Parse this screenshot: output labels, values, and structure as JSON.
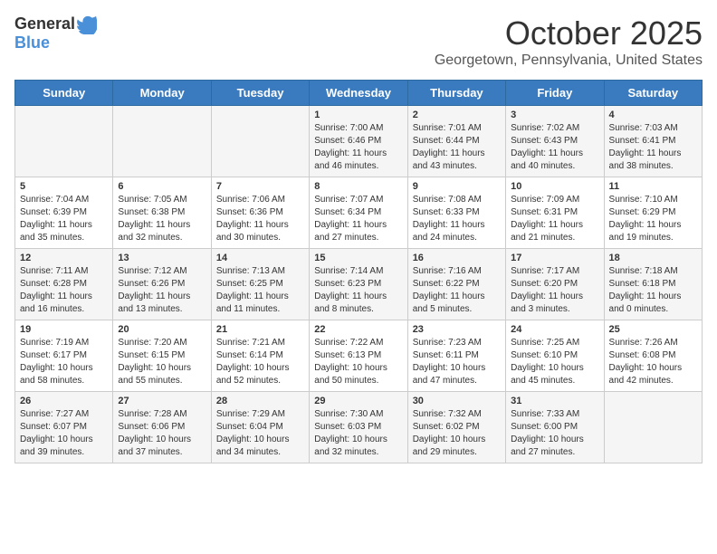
{
  "header": {
    "logo_general": "General",
    "logo_blue": "Blue",
    "month_title": "October 2025",
    "location": "Georgetown, Pennsylvania, United States"
  },
  "days_of_week": [
    "Sunday",
    "Monday",
    "Tuesday",
    "Wednesday",
    "Thursday",
    "Friday",
    "Saturday"
  ],
  "weeks": [
    [
      {
        "day": "",
        "info": ""
      },
      {
        "day": "",
        "info": ""
      },
      {
        "day": "",
        "info": ""
      },
      {
        "day": "1",
        "info": "Sunrise: 7:00 AM\nSunset: 6:46 PM\nDaylight: 11 hours and 46 minutes."
      },
      {
        "day": "2",
        "info": "Sunrise: 7:01 AM\nSunset: 6:44 PM\nDaylight: 11 hours and 43 minutes."
      },
      {
        "day": "3",
        "info": "Sunrise: 7:02 AM\nSunset: 6:43 PM\nDaylight: 11 hours and 40 minutes."
      },
      {
        "day": "4",
        "info": "Sunrise: 7:03 AM\nSunset: 6:41 PM\nDaylight: 11 hours and 38 minutes."
      }
    ],
    [
      {
        "day": "5",
        "info": "Sunrise: 7:04 AM\nSunset: 6:39 PM\nDaylight: 11 hours and 35 minutes."
      },
      {
        "day": "6",
        "info": "Sunrise: 7:05 AM\nSunset: 6:38 PM\nDaylight: 11 hours and 32 minutes."
      },
      {
        "day": "7",
        "info": "Sunrise: 7:06 AM\nSunset: 6:36 PM\nDaylight: 11 hours and 30 minutes."
      },
      {
        "day": "8",
        "info": "Sunrise: 7:07 AM\nSunset: 6:34 PM\nDaylight: 11 hours and 27 minutes."
      },
      {
        "day": "9",
        "info": "Sunrise: 7:08 AM\nSunset: 6:33 PM\nDaylight: 11 hours and 24 minutes."
      },
      {
        "day": "10",
        "info": "Sunrise: 7:09 AM\nSunset: 6:31 PM\nDaylight: 11 hours and 21 minutes."
      },
      {
        "day": "11",
        "info": "Sunrise: 7:10 AM\nSunset: 6:29 PM\nDaylight: 11 hours and 19 minutes."
      }
    ],
    [
      {
        "day": "12",
        "info": "Sunrise: 7:11 AM\nSunset: 6:28 PM\nDaylight: 11 hours and 16 minutes."
      },
      {
        "day": "13",
        "info": "Sunrise: 7:12 AM\nSunset: 6:26 PM\nDaylight: 11 hours and 13 minutes."
      },
      {
        "day": "14",
        "info": "Sunrise: 7:13 AM\nSunset: 6:25 PM\nDaylight: 11 hours and 11 minutes."
      },
      {
        "day": "15",
        "info": "Sunrise: 7:14 AM\nSunset: 6:23 PM\nDaylight: 11 hours and 8 minutes."
      },
      {
        "day": "16",
        "info": "Sunrise: 7:16 AM\nSunset: 6:22 PM\nDaylight: 11 hours and 5 minutes."
      },
      {
        "day": "17",
        "info": "Sunrise: 7:17 AM\nSunset: 6:20 PM\nDaylight: 11 hours and 3 minutes."
      },
      {
        "day": "18",
        "info": "Sunrise: 7:18 AM\nSunset: 6:18 PM\nDaylight: 11 hours and 0 minutes."
      }
    ],
    [
      {
        "day": "19",
        "info": "Sunrise: 7:19 AM\nSunset: 6:17 PM\nDaylight: 10 hours and 58 minutes."
      },
      {
        "day": "20",
        "info": "Sunrise: 7:20 AM\nSunset: 6:15 PM\nDaylight: 10 hours and 55 minutes."
      },
      {
        "day": "21",
        "info": "Sunrise: 7:21 AM\nSunset: 6:14 PM\nDaylight: 10 hours and 52 minutes."
      },
      {
        "day": "22",
        "info": "Sunrise: 7:22 AM\nSunset: 6:13 PM\nDaylight: 10 hours and 50 minutes."
      },
      {
        "day": "23",
        "info": "Sunrise: 7:23 AM\nSunset: 6:11 PM\nDaylight: 10 hours and 47 minutes."
      },
      {
        "day": "24",
        "info": "Sunrise: 7:25 AM\nSunset: 6:10 PM\nDaylight: 10 hours and 45 minutes."
      },
      {
        "day": "25",
        "info": "Sunrise: 7:26 AM\nSunset: 6:08 PM\nDaylight: 10 hours and 42 minutes."
      }
    ],
    [
      {
        "day": "26",
        "info": "Sunrise: 7:27 AM\nSunset: 6:07 PM\nDaylight: 10 hours and 39 minutes."
      },
      {
        "day": "27",
        "info": "Sunrise: 7:28 AM\nSunset: 6:06 PM\nDaylight: 10 hours and 37 minutes."
      },
      {
        "day": "28",
        "info": "Sunrise: 7:29 AM\nSunset: 6:04 PM\nDaylight: 10 hours and 34 minutes."
      },
      {
        "day": "29",
        "info": "Sunrise: 7:30 AM\nSunset: 6:03 PM\nDaylight: 10 hours and 32 minutes."
      },
      {
        "day": "30",
        "info": "Sunrise: 7:32 AM\nSunset: 6:02 PM\nDaylight: 10 hours and 29 minutes."
      },
      {
        "day": "31",
        "info": "Sunrise: 7:33 AM\nSunset: 6:00 PM\nDaylight: 10 hours and 27 minutes."
      },
      {
        "day": "",
        "info": ""
      }
    ]
  ]
}
